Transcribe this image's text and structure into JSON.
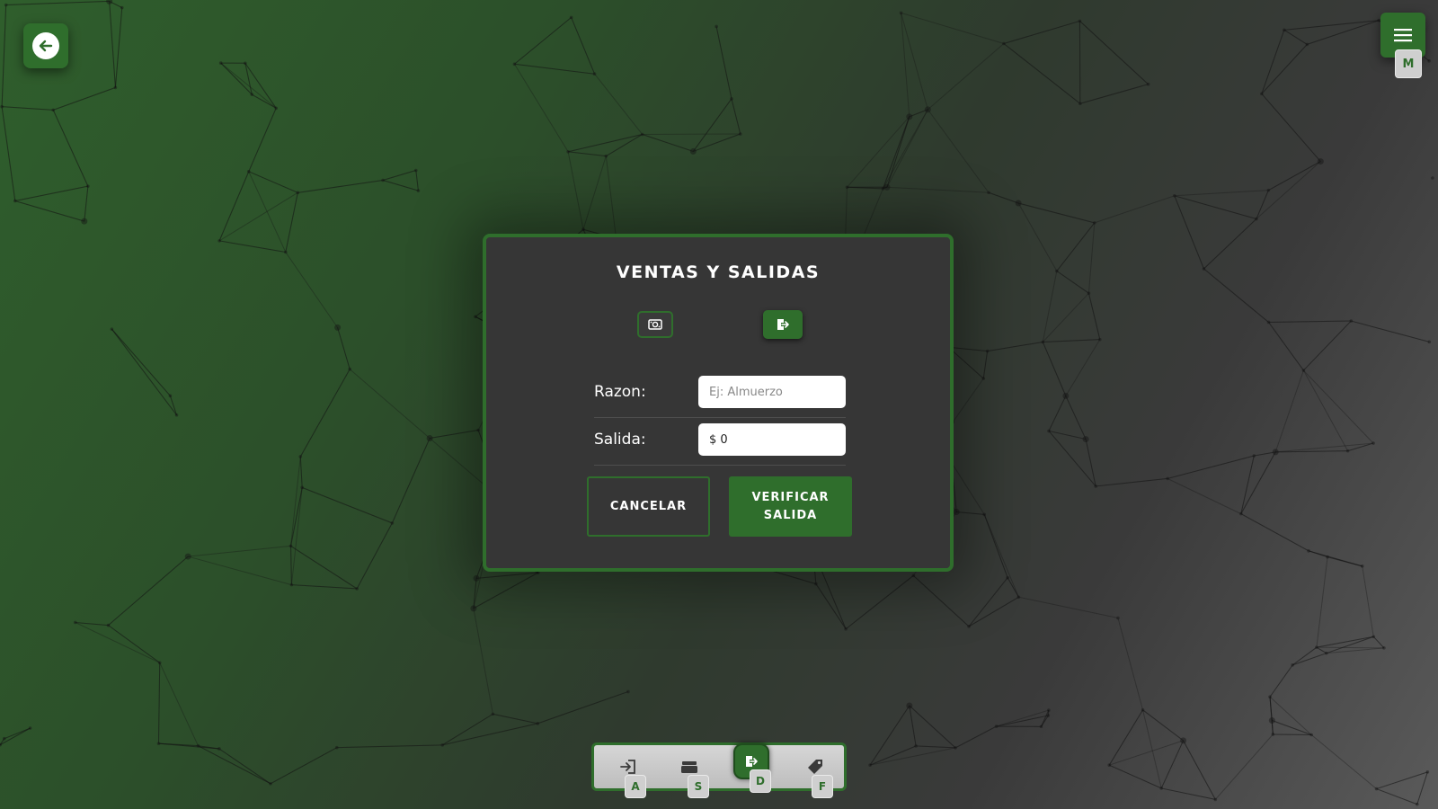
{
  "colors": {
    "accent": "#2f6e2c",
    "panel": "#363636",
    "text": "#ffffff"
  },
  "top_left": {
    "back_icon": "arrow-left-icon"
  },
  "top_right": {
    "menu_icon": "hamburger-menu-icon",
    "menu_shortcut": "M"
  },
  "modal": {
    "title": "VENTAS Y SALIDAS",
    "mode_buttons": [
      {
        "icon": "cash-icon",
        "active": false
      },
      {
        "icon": "exit-icon",
        "active": true
      }
    ],
    "fields": {
      "razon_label": "Razon:",
      "razon_placeholder": "Ej: Almuerzo",
      "razon_value": "",
      "salida_label": "Salida:",
      "salida_value": "$ 0"
    },
    "cancel_label": "CANCELAR",
    "verify_label_line1": "VERIFICAR",
    "verify_label_line2": "SALIDA"
  },
  "dock": {
    "items": [
      {
        "icon": "login-icon",
        "shortcut": "A",
        "active": false
      },
      {
        "icon": "stack-icon",
        "shortcut": "S",
        "active": false
      },
      {
        "icon": "exit-icon",
        "shortcut": "D",
        "active": true
      },
      {
        "icon": "tag-icon",
        "shortcut": "F",
        "active": false
      }
    ]
  }
}
